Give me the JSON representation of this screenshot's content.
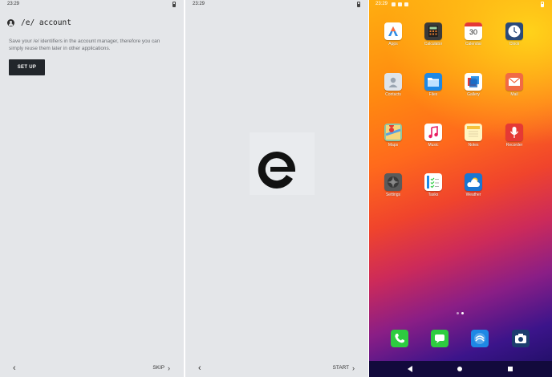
{
  "screens": [
    {
      "status_time": "23:29",
      "account_title": "/e/ account",
      "description": "Save your /e/ identifiers in the account manager, therefore you can simply reuse them later in other applications.",
      "setup_label": "SET UP",
      "back_glyph": "‹",
      "skip_label": "SKIP",
      "forward_glyph": "›"
    },
    {
      "status_time": "23:29",
      "logo": "e-logo",
      "back_glyph": "‹",
      "start_label": "START",
      "forward_glyph": "›"
    },
    {
      "status_time": "23:29",
      "apps": [
        {
          "label": "Apps",
          "icon": "apps-icon",
          "color": "#ffffff"
        },
        {
          "label": "Calculator",
          "icon": "calculator-icon",
          "color": "#3a3a3a"
        },
        {
          "label": "Calendar",
          "icon": "calendar-icon",
          "color": "#ffffff",
          "value": "30"
        },
        {
          "label": "Clock",
          "icon": "clock-icon",
          "color": "#2a4a7a"
        },
        {
          "label": "Contacts",
          "icon": "contacts-icon",
          "color": "#dfe4ea"
        },
        {
          "label": "Files",
          "icon": "files-icon",
          "color": "#1e88e5"
        },
        {
          "label": "Gallery",
          "icon": "gallery-icon",
          "color": "#ffffff"
        },
        {
          "label": "Mail",
          "icon": "mail-icon",
          "color": "#f16a45"
        },
        {
          "label": "Maps",
          "icon": "maps-icon",
          "color": "#8ec7a5"
        },
        {
          "label": "Music",
          "icon": "music-icon",
          "color": "#ffffff"
        },
        {
          "label": "Notes",
          "icon": "notes-icon",
          "color": "#fff4c2"
        },
        {
          "label": "Recorder",
          "icon": "recorder-icon",
          "color": "#e53935"
        },
        {
          "label": "Settings",
          "icon": "settings-icon",
          "color": "#5a5a5a"
        },
        {
          "label": "Tasks",
          "icon": "tasks-icon",
          "color": "#ffffff"
        },
        {
          "label": "Weather",
          "icon": "weather-icon",
          "color": "#1976d2"
        }
      ],
      "dock": [
        {
          "icon": "phone-icon",
          "color": "#2ecc40"
        },
        {
          "icon": "messages-icon",
          "color": "#2ecc40"
        },
        {
          "icon": "browser-icon",
          "color": "#1e88e5"
        },
        {
          "icon": "camera-icon",
          "color": "#1c3d6e"
        }
      ],
      "page_indicator": {
        "pages": 2,
        "current": 2
      }
    }
  ]
}
